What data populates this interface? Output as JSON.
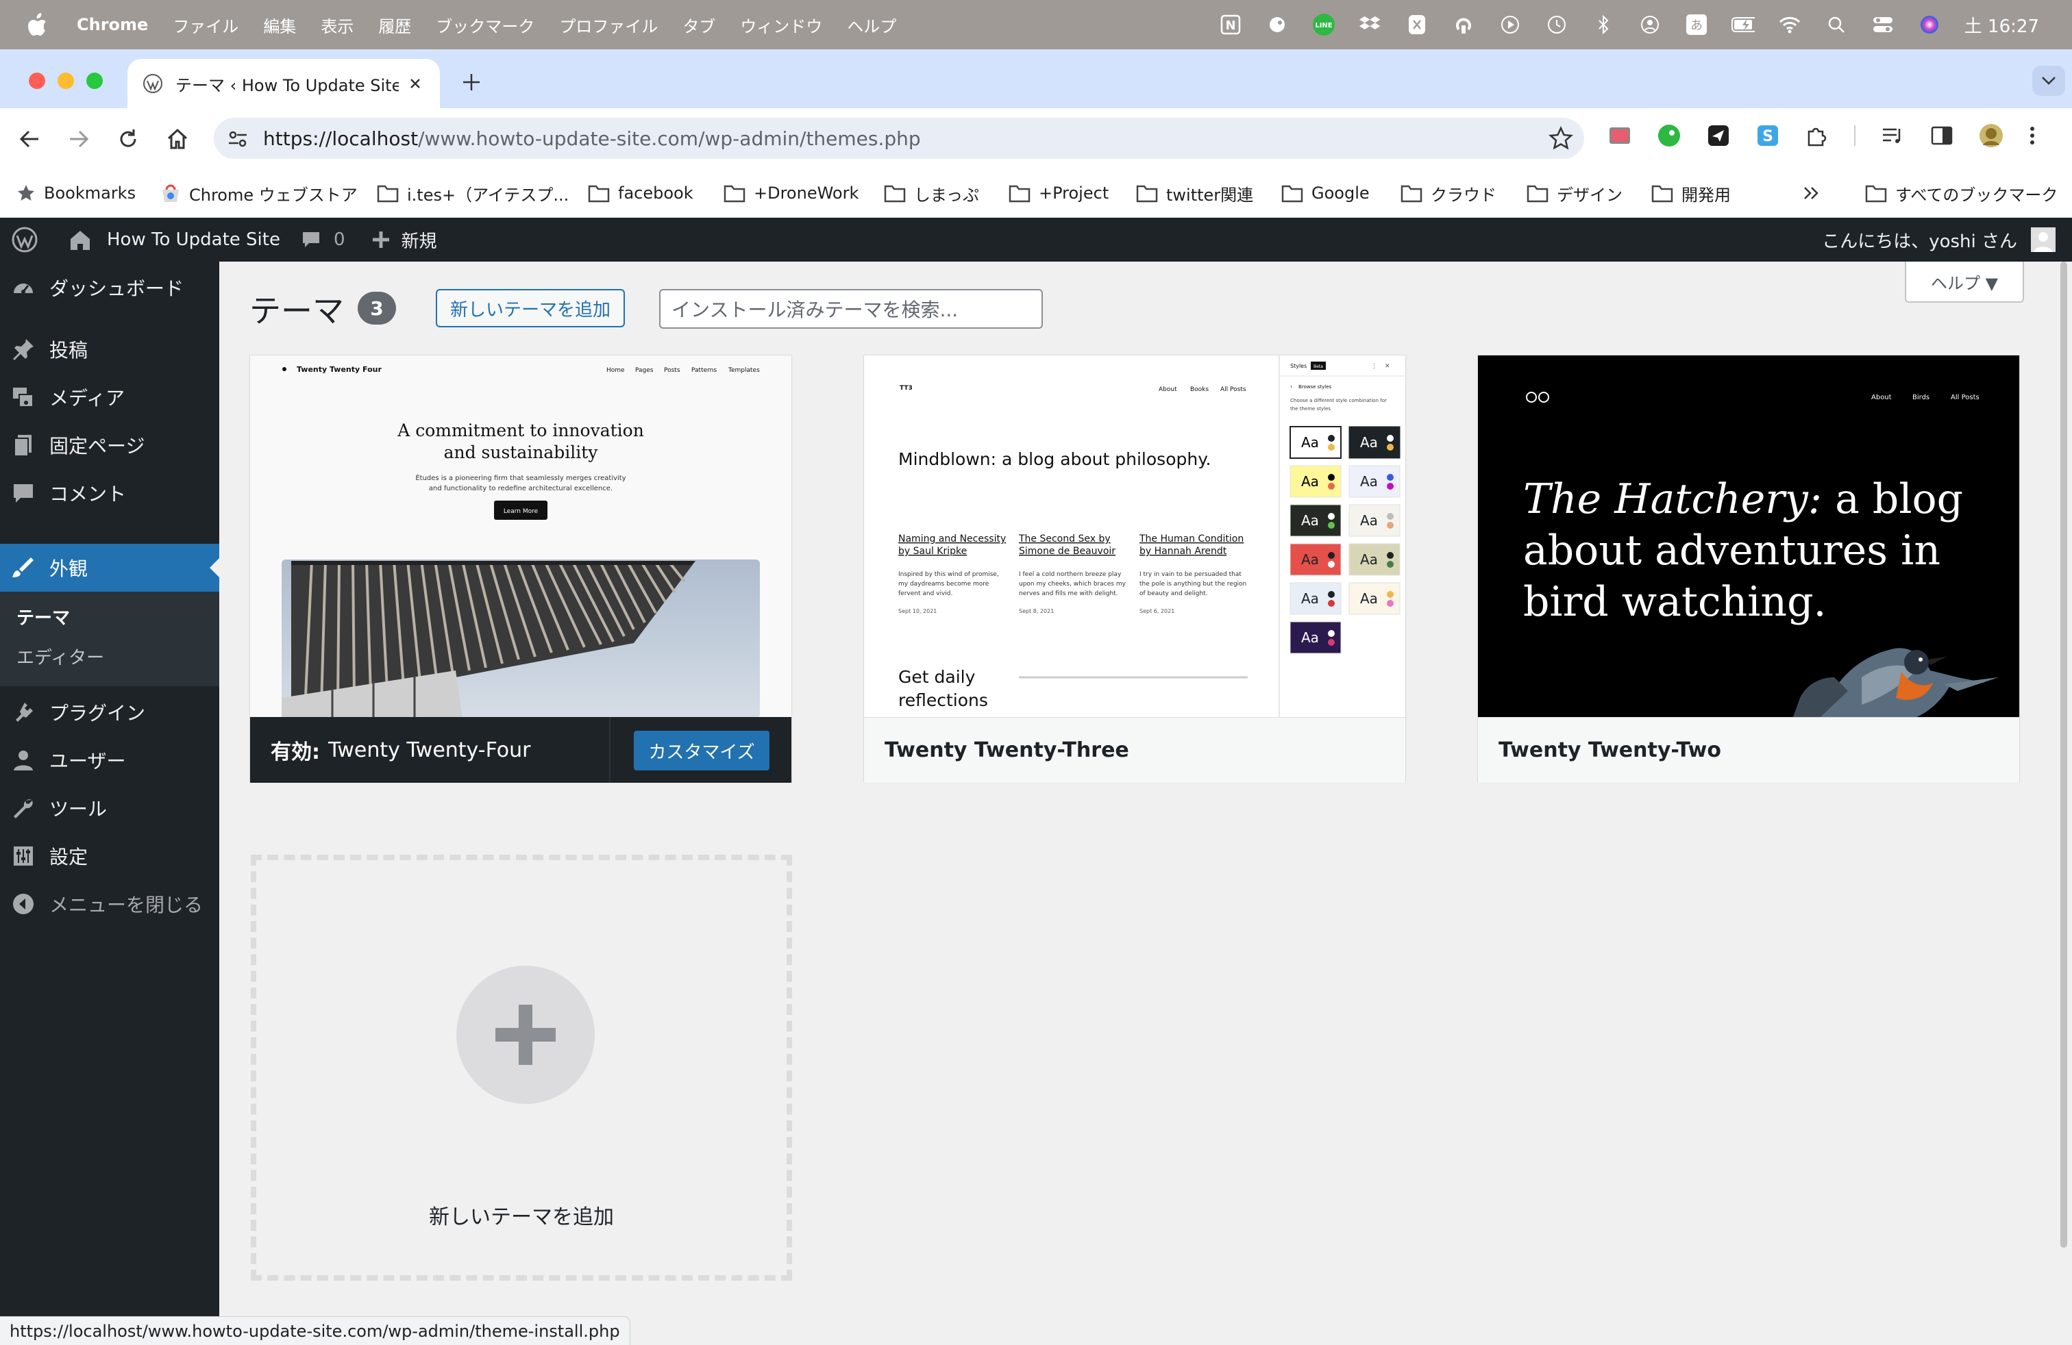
{
  "macos": {
    "app_name": "Chrome",
    "menus": [
      "ファイル",
      "編集",
      "表示",
      "履歴",
      "ブックマーク",
      "プロファイル",
      "タブ",
      "ウィンドウ",
      "ヘルプ"
    ],
    "clock": "土 16:27",
    "tray_text": {
      "line": "LINE",
      "ime": "あ"
    }
  },
  "browser": {
    "tab_title": "テーマ ‹ How To Update Site –",
    "url_host": "https://localhost",
    "url_path": "/www.howto-update-site.com/wp-admin/themes.php",
    "status_url": "https://localhost/www.howto-update-site.com/wp-admin/theme-install.php",
    "bookmarks": [
      {
        "label": "Bookmarks",
        "icon": "star-icon"
      },
      {
        "label": "Chrome ウェブストア",
        "icon": "webstore-icon"
      },
      {
        "label": "i.tes+（アイテスプ...",
        "icon": "folder-icon"
      },
      {
        "label": "facebook",
        "icon": "folder-icon"
      },
      {
        "label": "+DroneWork",
        "icon": "folder-icon"
      },
      {
        "label": "しまっぷ",
        "icon": "folder-icon"
      },
      {
        "label": "+Project",
        "icon": "folder-icon"
      },
      {
        "label": "twitter関連",
        "icon": "folder-icon"
      },
      {
        "label": "Google",
        "icon": "folder-icon"
      },
      {
        "label": "クラウド",
        "icon": "folder-icon"
      },
      {
        "label": "デザイン",
        "icon": "folder-icon"
      },
      {
        "label": "開発用",
        "icon": "folder-icon"
      }
    ],
    "all_bookmarks": "すべてのブックマーク"
  },
  "adminbar": {
    "site_name": "How To Update Site",
    "comments_count": "0",
    "new_label": "新規",
    "greeting": "こんにちは、yoshi さん"
  },
  "sidebar": {
    "items": [
      {
        "label": "ダッシュボード"
      },
      {
        "label": "投稿"
      },
      {
        "label": "メディア"
      },
      {
        "label": "固定ページ"
      },
      {
        "label": "コメント"
      },
      {
        "label": "外観"
      },
      {
        "label": "プラグイン"
      },
      {
        "label": "ユーザー"
      },
      {
        "label": "ツール"
      },
      {
        "label": "設定"
      },
      {
        "label": "メニューを閉じる"
      }
    ],
    "submenu": [
      "テーマ",
      "エディター"
    ]
  },
  "page": {
    "title": "テーマ",
    "count": "3",
    "add_button": "新しいテーマを追加",
    "search_placeholder": "インストール済みテーマを検索...",
    "help": "ヘルプ ▼",
    "active_prefix": "有効:",
    "active_theme": "Twenty Twenty-Four",
    "customize": "カスタマイズ",
    "themes": [
      "Twenty Twenty-Four",
      "Twenty Twenty-Three",
      "Twenty Twenty-Two"
    ],
    "add_card_label": "新しいテーマを追加"
  },
  "tt4": {
    "brand": "Twenty Twenty Four",
    "nav": [
      "Home",
      "Pages",
      "Posts",
      "Patterns",
      "Templates"
    ],
    "headline1": "A commitment to innovation",
    "headline2": "and sustainability",
    "body1": "Études is a pioneering firm that seamlessly merges creativity",
    "body2": "and functionality to redefine architectural excellence.",
    "cta": "Learn More"
  },
  "tt3": {
    "brand": "TT3",
    "nav": [
      "About",
      "Books",
      "All Posts"
    ],
    "headline": "Mindblown: a blog about philosophy.",
    "posts": [
      {
        "t1": "Naming and Necessity",
        "t2": "by Saul Kripke",
        "b1": "Inspired by this wind of promise,",
        "b2": "my daydreams become more",
        "b3": "fervent and vivid.",
        "date": "Sept 10, 2021"
      },
      {
        "t1": "The Second Sex by",
        "t2": "Simone de Beauvoir",
        "b1": "I feel a cold northern breeze play",
        "b2": "upon my cheeks, which braces my",
        "b3": "nerves and fills me with delight.",
        "date": "Sept 8, 2021"
      },
      {
        "t1": "The Human Condition",
        "t2": "by Hannah Arendt",
        "b1": "I try in vain to be persuaded that",
        "b2": "the pole is anything but the region",
        "b3": "of beauty and delight.",
        "date": "Sept 6, 2021"
      }
    ],
    "reflect1": "Get daily",
    "reflect2": "reflections",
    "styles_title": "Styles",
    "beta": "Beta",
    "browse": "Browse styles",
    "choose1": "Choose a different style combination for",
    "choose2": "the theme styles",
    "swatch_label": "Aa",
    "swatches": [
      {
        "bg": "#ffffff",
        "fg": "#000000",
        "d1": "#1d2327",
        "d2": "#f0b849",
        "border": "#1d2327"
      },
      {
        "bg": "#1d2327",
        "fg": "#ffffff",
        "d1": "#ffffff",
        "d2": "#f0b849",
        "border": "#1d2327"
      },
      {
        "bg": "#fff79a",
        "fg": "#000000",
        "d1": "#000000",
        "d2": "#e26b48",
        "border": "#e0e0e0"
      },
      {
        "bg": "#eef0fb",
        "fg": "#1d2327",
        "d1": "#3858e9",
        "d2": "#c10ccc",
        "border": "#e0e0e0"
      },
      {
        "bg": "#252a24",
        "fg": "#ffffff",
        "d1": "#ffffff",
        "d2": "#66c050",
        "border": "#e0e0e0"
      },
      {
        "bg": "#f5f3ee",
        "fg": "#1d2327",
        "d1": "#bcbcbc",
        "d2": "#e5a679",
        "border": "#e0e0e0"
      },
      {
        "bg": "#e5504a",
        "fg": "#1d2327",
        "d1": "#1d2327",
        "d2": "#ffffff",
        "border": "#e0e0e0"
      },
      {
        "bg": "#d9d6b8",
        "fg": "#1d2327",
        "d1": "#1d2327",
        "d2": "#4a7a4a",
        "border": "#e0e0e0"
      },
      {
        "bg": "#e8eef6",
        "fg": "#1d2327",
        "d1": "#1d2327",
        "d2": "#d93838",
        "border": "#e0e0e0"
      },
      {
        "bg": "#fcf6e8",
        "fg": "#1d2327",
        "d1": "#f0b849",
        "d2": "#e875c6",
        "border": "#e0e0e0"
      },
      {
        "bg": "#2a1a4e",
        "fg": "#ffffff",
        "d1": "#ffffff",
        "d2": "#d93870",
        "border": "#e0e0e0"
      }
    ]
  },
  "tt2": {
    "nav": [
      "About",
      "Birds",
      "All Posts"
    ],
    "line1_em": "The Hatchery:",
    "line1": " a blog",
    "line2": "about adventures in",
    "line3": "bird watching."
  },
  "colors": {
    "wp_blue": "#2271b1",
    "admin_dark": "#1d2327",
    "active_menu": "#2271b1"
  }
}
